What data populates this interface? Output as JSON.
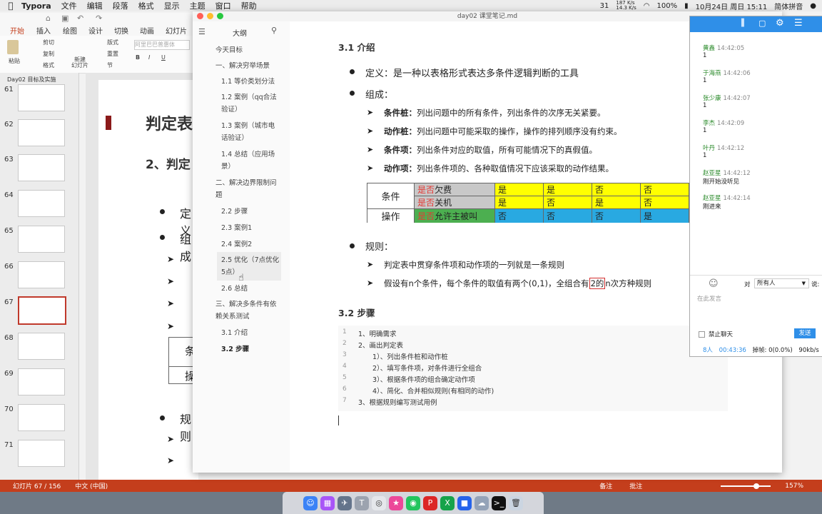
{
  "menubar": {
    "app": "Typora",
    "items": [
      "文件",
      "编辑",
      "段落",
      "格式",
      "显示",
      "主题",
      "窗口",
      "帮助"
    ],
    "status": {
      "net_up": "187 K/s",
      "net_down": "14.3 K/s",
      "battery": "100%",
      "datetime": "10月24日 周日 15:11",
      "input_method": "简体拼音",
      "count": "31"
    }
  },
  "ppt": {
    "tabs": [
      "开始",
      "插入",
      "绘图",
      "设计",
      "切换",
      "动画",
      "幻灯片放"
    ],
    "ribbon": {
      "paste": "粘贴",
      "cut": "剪切",
      "copy": "复制",
      "format": "格式",
      "new_slide": "新建\n幻灯片",
      "layout": "版式",
      "reset": "重置",
      "section": "节",
      "font_placeholder": "阿里巴巴普惠体"
    },
    "section_title": "Day02 目标及实施",
    "slide_numbers": [
      "61",
      "62",
      "63",
      "64",
      "65",
      "66",
      "67",
      "68",
      "69",
      "70",
      "71"
    ],
    "selected_slide": "67",
    "slide_texts": {
      "title": "判定表",
      "subtitle": "2、判定",
      "b1": "定义",
      "b2": "组成",
      "b3": "规则",
      "t1": "条",
      "t2": "操"
    },
    "statusbar": {
      "slide_count": "幻灯片 67 / 156",
      "lang": "中文 (中国)",
      "notes": "备注",
      "comments": "批注",
      "zoom": "157%"
    }
  },
  "typora": {
    "filename": "day02 课堂笔记.md",
    "outline_title": "大纲",
    "outline": [
      {
        "text": "今天目标",
        "level": 0
      },
      {
        "text": "一、解决穷举场景",
        "level": 0
      },
      {
        "text": "1.1 等价类划分法",
        "level": 1
      },
      {
        "text": "1.2 案例（qq合法",
        "level": 1
      },
      {
        "text": "验证）",
        "level": 1
      },
      {
        "text": "1.3 案例（城市电",
        "level": 1
      },
      {
        "text": "话验证）",
        "level": 1
      },
      {
        "text": "1.4 总结（应用场",
        "level": 1
      },
      {
        "text": "景）",
        "level": 1
      },
      {
        "text": "二、解决边界限制问",
        "level": 0
      },
      {
        "text": "题",
        "level": 0
      },
      {
        "text": "2.2 步骤",
        "level": 1
      },
      {
        "text": "2.3 案例1",
        "level": 1
      },
      {
        "text": "2.4 案例2",
        "level": 1
      },
      {
        "text": "2.5 优化（7点优化",
        "level": 1
      },
      {
        "text": "5点）",
        "level": 1
      },
      {
        "text": "2.6 总结",
        "level": 1
      },
      {
        "text": "三、解决多条件有依",
        "level": 0
      },
      {
        "text": "赖关系测试",
        "level": 0
      },
      {
        "text": "3.1 介绍",
        "level": 1
      },
      {
        "text": "3.2 步骤",
        "level": 1
      }
    ],
    "content": {
      "h31": "3.1 介绍",
      "definition": "定义：是一种以表格形式表达多条件逻辑判断的工具",
      "composition": "组成：",
      "items": [
        {
          "term": "条件桩：",
          "desc": "列出问题中的所有条件，列出条件的次序无关紧要。"
        },
        {
          "term": "动作桩：",
          "desc": "列出问题中可能采取的操作，操作的排列顺序没有约束。"
        },
        {
          "term": "条件项：",
          "desc": "列出条件对应的取值，所有可能情况下的真假值。"
        },
        {
          "term": "动作项：",
          "desc": "列出条件项的、各种取值情况下应该采取的动作结果。"
        }
      ],
      "table": {
        "cond_label": "条件",
        "act_label": "操作",
        "rows": [
          {
            "prefix": "是否",
            "name": "欠费",
            "vals": [
              "是",
              "是",
              "否",
              "否"
            ]
          },
          {
            "prefix": "是否",
            "name": "关机",
            "vals": [
              "是",
              "否",
              "是",
              "否"
            ]
          },
          {
            "prefix": "是否",
            "name": "允许主被叫",
            "vals": [
              "否",
              "否",
              "否",
              "是"
            ]
          }
        ]
      },
      "rules": "规则：",
      "rule1": "判定表中贯穿条件项和动作项的一列就是一条规则",
      "rule2_a": "假设有n个条件，每个条件的取值有两个(0,1)，全组合有",
      "rule2_box": "2的",
      "rule2_b": "n次方种规则",
      "h32": "3.2 步骤",
      "steps": [
        {
          "n": "1",
          "text": "1、明确需求"
        },
        {
          "n": "2",
          "text": "2、画出判定表"
        },
        {
          "n": "3",
          "text": "1）、列出条件桩和动作桩"
        },
        {
          "n": "4",
          "text": "2）、填写条件项，对条件进行全组合"
        },
        {
          "n": "5",
          "text": "3）、根据条件项的组合确定动作项"
        },
        {
          "n": "6",
          "text": "4）、简化、合并相似规则(有相同的动作)"
        },
        {
          "n": "7",
          "text": "3、根据规则编写测试用例"
        }
      ]
    }
  },
  "chat": {
    "messages": [
      {
        "name": "黄鑫",
        "time": "14:42:05",
        "text": "1"
      },
      {
        "name": "于海燕",
        "time": "14:42:06",
        "text": "1"
      },
      {
        "name": "张少康",
        "time": "14:42:07",
        "text": "1"
      },
      {
        "name": "李杰",
        "time": "14:42:09",
        "text": "1"
      },
      {
        "name": "叶丹",
        "time": "14:42:12",
        "text": "1"
      },
      {
        "name": "赵亚星",
        "time": "14:42:12",
        "text": "刚开始没听见"
      },
      {
        "name": "赵亚星",
        "time": "14:42:14",
        "text": "刚进来"
      }
    ],
    "to_label": "对",
    "to_value": "所有人",
    "say_label": "说:",
    "placeholder": "在此发言",
    "ban_chat": "禁止聊天",
    "send": "发送",
    "stats": {
      "people": "8人",
      "duration": "00:43:36",
      "queue": "掉帧: 0(0.0%)",
      "rate": "90kb/s"
    }
  },
  "colors": {
    "ppt_accent": "#c43e1c",
    "chat_blue": "#2f8fe8",
    "yellow": "#ffff00",
    "gray": "#c8c8c8",
    "green": "#4caf50",
    "blue": "#29a9e1",
    "red": "#e53935"
  }
}
